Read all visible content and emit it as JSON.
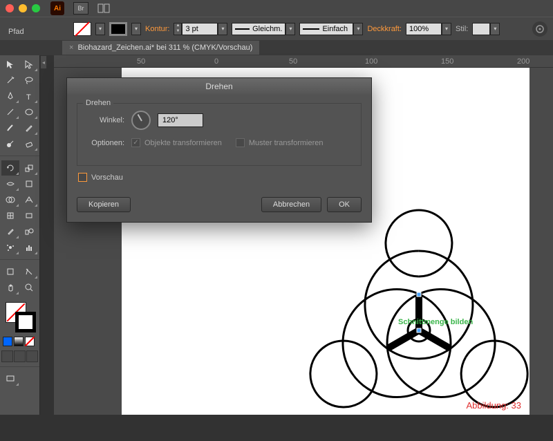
{
  "app": {
    "icon_text": "Ai",
    "br_label": "Br"
  },
  "path_label": "Pfad",
  "controlbar": {
    "stroke_label": "Kontur:",
    "stroke_weight": "3 pt",
    "profile_label": "Gleichm.",
    "brush_label": "Einfach",
    "opacity_label": "Deckkraft:",
    "opacity_value": "100%",
    "style_label": "Stil:"
  },
  "tab": {
    "title": "Biohazard_Zeichen.ai* bei 311 % (CMYK/Vorschau)"
  },
  "ruler": {
    "marks": [
      "50",
      "0",
      "50",
      "100",
      "150",
      "200"
    ]
  },
  "dialog": {
    "title": "Drehen",
    "fieldset_legend": "Drehen",
    "angle_label": "Winkel:",
    "angle_value": "120°",
    "options_label": "Optionen:",
    "opt_objects": "Objekte transformieren",
    "opt_patterns": "Muster transformieren",
    "preview_label": "Vorschau",
    "btn_copy": "Kopieren",
    "btn_cancel": "Abbrechen",
    "btn_ok": "OK"
  },
  "annotation_text": "Schnittmenge bilden",
  "figure_label": "Abbildung: 33"
}
